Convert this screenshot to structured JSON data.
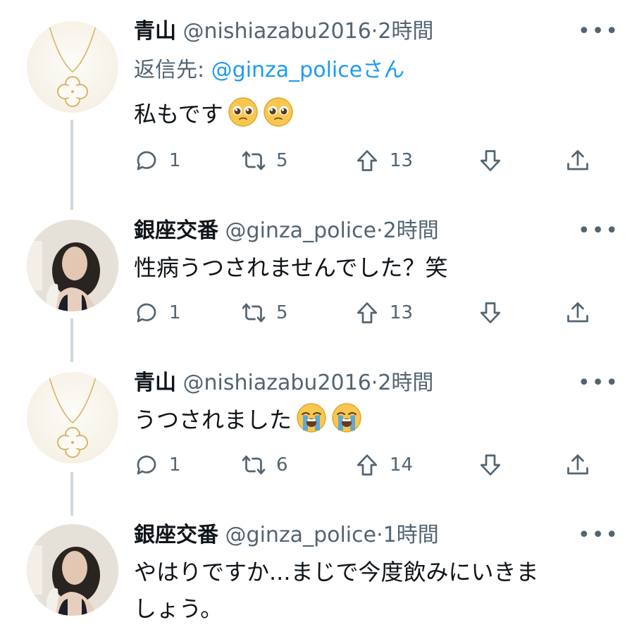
{
  "tweets": [
    {
      "name": "青山",
      "handle": "@nishiazabu2016",
      "sep": "·",
      "time": "2時間",
      "reply_prefix": "返信先: ",
      "reply_mention": "@ginza_police",
      "reply_suffix": "さん",
      "text": "私もです",
      "emoji": [
        "pleading-face-emoji",
        "pleading-face-emoji"
      ],
      "replies": "1",
      "retweets": "5",
      "upvotes": "13"
    },
    {
      "name": "銀座交番",
      "handle": "@ginza_police",
      "sep": "·",
      "time": "2時間",
      "text": "性病うつされませんでした？笑",
      "replies": "1",
      "retweets": "5",
      "upvotes": "13"
    },
    {
      "name": "青山",
      "handle": "@nishiazabu2016",
      "sep": "·",
      "time": "2時間",
      "text": "うつされました",
      "emoji": [
        "crying-face-emoji",
        "crying-face-emoji"
      ],
      "replies": "1",
      "retweets": "6",
      "upvotes": "14"
    },
    {
      "name": "銀座交番",
      "handle": "@ginza_police",
      "sep": "·",
      "time": "1時間",
      "text_line1": "やはりですか...まじで今度飲みにいきま",
      "text_line2": "しょう。"
    }
  ],
  "more_label": "•••",
  "colors": {
    "text": "#0f1419",
    "muted": "#536471",
    "link": "#1d9bf0",
    "thread": "#cfd9de"
  }
}
